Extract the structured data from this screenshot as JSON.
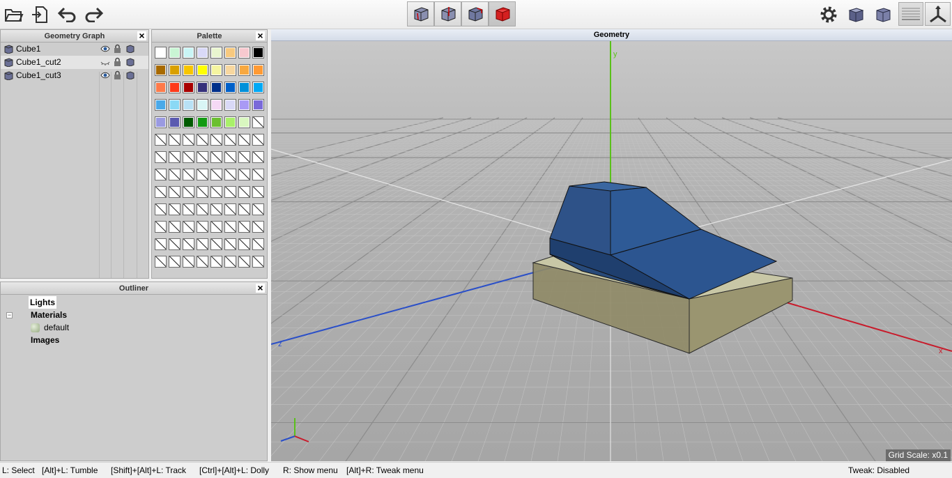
{
  "toolbar": {
    "left_buttons": [
      "open-folder-icon",
      "import-icon",
      "undo-icon",
      "redo-icon"
    ],
    "view_modes": [
      "wireframe-cube-icon",
      "axis-cube-icon",
      "shaded-wire-cube-icon",
      "solid-red-cube-icon"
    ],
    "right_buttons": [
      "settings-gear-icon",
      "shaded-cube-icon",
      "cube-outline-icon",
      "grid-floor-icon",
      "axes-icon"
    ]
  },
  "geometry_graph": {
    "title": "Geometry Graph",
    "items": [
      {
        "name": "Cube1",
        "visible": true
      },
      {
        "name": "Cube1_cut2",
        "visible": false,
        "selected": true
      },
      {
        "name": "Cube1_cut3",
        "visible": true
      }
    ]
  },
  "palette": {
    "title": "Palette",
    "colors": [
      "#ffffff",
      "#c9f5d4",
      "#c9f5f5",
      "#d9d9f7",
      "#e9f5cf",
      "#f7c97f",
      "#f7c9cf",
      "#000000",
      "#a86a00",
      "#d9a000",
      "#f7c500",
      "#ffff00",
      "#f5f5a0",
      "#f7d79f",
      "#f7a840",
      "#ff9a33",
      "#ff7a4a",
      "#ff3a1a",
      "#a80000",
      "#36307a",
      "#00308a",
      "#0060c9",
      "#0090d9",
      "#00a9f5",
      "#4aa9e9",
      "#8ad9f5",
      "#b8e1f5",
      "#d9f5f5",
      "#f5d9f5",
      "#d9d9f7",
      "#a99af5",
      "#7a6ad9",
      "#9a9ae1",
      "#5a5ab0",
      "#005a00",
      "#139a13",
      "#6ac030",
      "#a9f06a",
      "#d9f7c0"
    ],
    "empty_count": 65
  },
  "outliner": {
    "title": "Outliner",
    "lights": "Lights",
    "materials": "Materials",
    "material_items": [
      "default"
    ],
    "images": "Images"
  },
  "viewport": {
    "title": "Geometry",
    "grid_scale": "Grid Scale: x0.1",
    "axis_labels": {
      "x": "x",
      "y": "y",
      "z": "z"
    }
  },
  "statusbar": {
    "select": "L: Select",
    "tumble": "[Alt]+L: Tumble",
    "track": "[Shift]+[Alt]+L: Track",
    "dolly": "[Ctrl]+[Alt]+L: Dolly",
    "show_menu": "R: Show menu",
    "tweak_menu": "[Alt]+R: Tweak menu",
    "tweak_status": "Tweak: Disabled"
  }
}
